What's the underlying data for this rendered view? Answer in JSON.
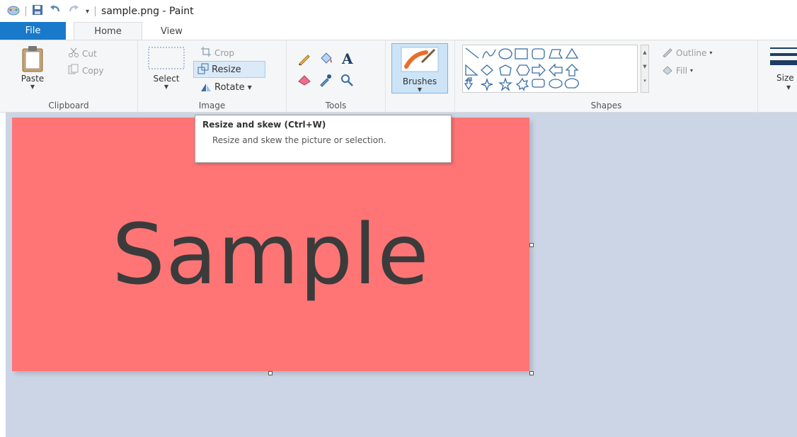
{
  "titlebar": {
    "title": "sample.png - Paint"
  },
  "tabs": {
    "file": "File",
    "home": "Home",
    "view": "View"
  },
  "clipboard": {
    "paste": "Paste",
    "cut": "Cut",
    "copy": "Copy",
    "label": "Clipboard"
  },
  "image": {
    "select": "Select",
    "crop": "Crop",
    "resize": "Resize",
    "rotate": "Rotate",
    "label": "Image"
  },
  "tools": {
    "label": "Tools",
    "text_glyph": "A"
  },
  "brushes": {
    "label": "Brushes"
  },
  "shapes": {
    "outline": "Outline",
    "fill": "Fill",
    "label": "Shapes"
  },
  "size": {
    "label": "Size"
  },
  "canvas": {
    "text": "Sample",
    "fill_color": "#ff7575"
  },
  "tooltip": {
    "title": "Resize and skew (Ctrl+W)",
    "body": "Resize and skew the picture or selection."
  },
  "colors": {
    "file_tab": "#1979ca",
    "workspace": "#ccd5e6"
  }
}
